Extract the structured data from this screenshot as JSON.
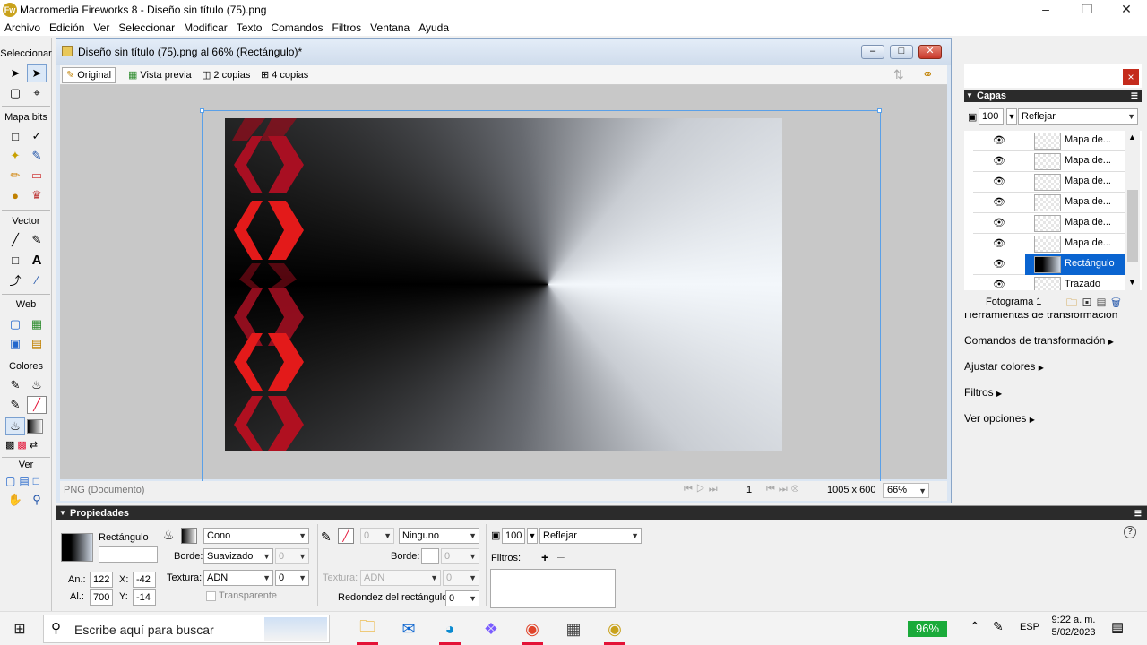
{
  "window": {
    "title": "Macromedia Fireworks 8 - Diseño sin título (75).png",
    "logo": "fireworks-logo"
  },
  "menubar": [
    "Archivo",
    "Edición",
    "Ver",
    "Seleccionar",
    "Modificar",
    "Texto",
    "Comandos",
    "Filtros",
    "Ventana",
    "Ayuda"
  ],
  "toolbox": {
    "sections": [
      "Seleccionar",
      "Mapa bits",
      "Vector",
      "Web",
      "Colores",
      "Ver"
    ]
  },
  "document": {
    "title": "Diseño sin título (75).png al  66% (Rectángulo)*",
    "tabs": [
      "Original",
      "Vista previa",
      "2 copias",
      "4 copias"
    ],
    "status_left": "PNG (Documento)",
    "frame_number": "1",
    "dimensions": "1005 x 600",
    "zoom": "66%"
  },
  "layers": {
    "opacity": "100",
    "blend_mode": "Reflejar",
    "header": "Capas",
    "rows": [
      "Mapa de...",
      "Mapa de...",
      "Mapa de...",
      "Mapa de...",
      "Mapa de...",
      "Mapa de...",
      "Rectángulo",
      "Trazado"
    ],
    "selected_index": 6,
    "frame_label": "Fotograma 1"
  },
  "panel_links": [
    "Herramientas de transformación",
    "Comandos de transformación",
    "Ajustar colores",
    "Filtros",
    "Ver opciones"
  ],
  "properties": {
    "header": "Propiedades",
    "object_type": "Rectángulo",
    "fill_type": "Cono",
    "edge_label": "Borde:",
    "edge_value": "Suavizado",
    "edge_amount": "0",
    "texture_label": "Textura:",
    "texture_value": "ADN",
    "texture_amount": "0",
    "transparent_label": "Transparente",
    "stroke_size": "0",
    "stroke_type": "Ninguno",
    "stroke_edge_label": "Borde:",
    "stroke_edge_value": "0",
    "stroke_texture_label": "Textura:",
    "stroke_texture_value": "ADN",
    "stroke_texture_amount": "0",
    "roundness_label": "Redondez del rectángulo:",
    "roundness_value": "0",
    "opacity": "100",
    "blend": "Reflejar",
    "filters_label": "Filtros:",
    "w_label": "An.:",
    "w_value": "122",
    "h_label": "Al.:",
    "h_value": "700",
    "x_label": "X:",
    "x_value": "-42",
    "y_label": "Y:",
    "y_value": "-14"
  },
  "taskbar": {
    "search_placeholder": "Escribe aquí para buscar",
    "battery": "96%",
    "language": "ESP",
    "time": "9:22 a. m.",
    "date": "5/02/2023"
  },
  "colors": {
    "accent": "#0078d7",
    "hive_red": "#e31337",
    "dark_header": "#2b2b2b"
  }
}
